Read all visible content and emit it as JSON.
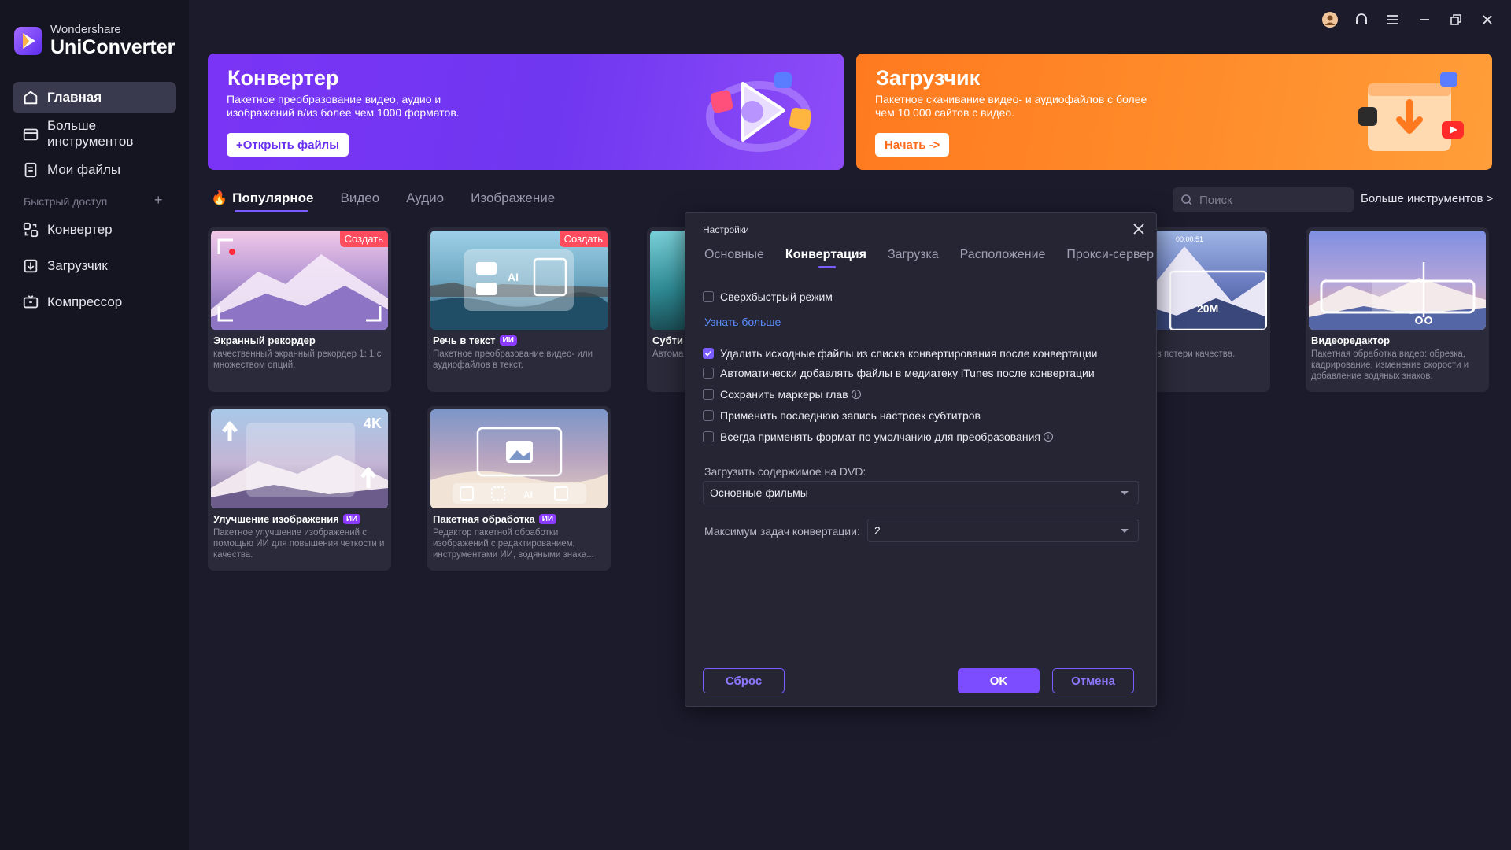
{
  "app": {
    "brand": "Wondershare",
    "product": "UniConverter"
  },
  "sidebar": {
    "items": [
      {
        "label": "Главная",
        "icon": "home-icon"
      },
      {
        "label": "Больше инструментов",
        "icon": "toolbox-icon"
      },
      {
        "label": "Мои файлы",
        "icon": "file-icon"
      }
    ],
    "quick_access_label": "Быстрый доступ",
    "quick_items": [
      {
        "label": "Конвертер",
        "icon": "converter-icon"
      },
      {
        "label": "Загрузчик",
        "icon": "downloader-icon"
      },
      {
        "label": "Компрессор",
        "icon": "compressor-icon"
      }
    ]
  },
  "banners": {
    "converter": {
      "title": "Конвертер",
      "desc": "Пакетное преобразование видео, аудио и изображений в/из более чем 1000 форматов.",
      "button": "+Открыть файлы",
      "color": "#7a34f5"
    },
    "downloader": {
      "title": "Загрузчик",
      "desc": "Пакетное скачивание видео- и аудиофайлов с более чем 10 000 сайтов с видео.",
      "button": "Начать ->",
      "color": "#ff7a1f"
    }
  },
  "tabs": [
    "Популярное",
    "Видео",
    "Аудио",
    "Изображение"
  ],
  "search": {
    "placeholder": "Поиск"
  },
  "more_tools": "Больше инструментов >",
  "cards": [
    {
      "title": "Экранный рекордер",
      "badge": "Создать",
      "desc": "качественный экранный рекордер 1: 1 с множеством опций."
    },
    {
      "title": "Речь в текст",
      "badge": "Создать",
      "ai": "ИИ",
      "desc": "Пакетное преобразование видео- или аудиофайлов в текст."
    },
    {
      "title": "Субти",
      "desc": "Автома редакт"
    },
    {
      "title": "",
      "desc": "тие видео- и без потери качества.",
      "timecode": "00:00:51",
      "size_label": "20M"
    },
    {
      "title": "Видеоредактор",
      "desc": "Пакетная обработка видео: обрезка, кадрирование, изменение скорости и добавление водяных знаков."
    },
    {
      "title": "Улучшение изображения",
      "ai": "ИИ",
      "desc": "Пакетное улучшение изображений с помощью ИИ для повышения четкости и качества.",
      "res_label": "4K"
    },
    {
      "title": "Пакетная обработка",
      "ai": "ИИ",
      "desc": "Редактор пакетной обработки изображений с редактированием, инструментами ИИ, водяными знака..."
    }
  ],
  "dialog": {
    "title": "Настройки",
    "tabs": [
      "Основные",
      "Конвертация",
      "Загрузка",
      "Расположение",
      "Прокси-сервер"
    ],
    "active_tab": "Конвертация",
    "options": [
      {
        "label": "Сверхбыстрый режим",
        "checked": false
      },
      {
        "label": "Удалить исходные файлы из списка конвертирования после конвертации",
        "checked": true
      },
      {
        "label": "Автоматически добавлять файлы в медиатеку iTunes после конвертации",
        "checked": false
      },
      {
        "label": "Сохранить маркеры глав",
        "checked": false,
        "info": true
      },
      {
        "label": "Применить последнюю запись настроек субтитров",
        "checked": false
      },
      {
        "label": "Всегда применять формат по умолчанию для преобразования",
        "checked": false,
        "info": true
      }
    ],
    "learn_more": "Узнать больше",
    "dvd_label": "Загрузить содержимое на DVD:",
    "dvd_value": "Основные фильмы",
    "max_tasks_label": "Максимум задач конвертации:",
    "max_tasks_value": "2",
    "buttons": {
      "reset": "Сброс",
      "ok": "OK",
      "cancel": "Отмена"
    }
  },
  "accent": "#7b5cff"
}
